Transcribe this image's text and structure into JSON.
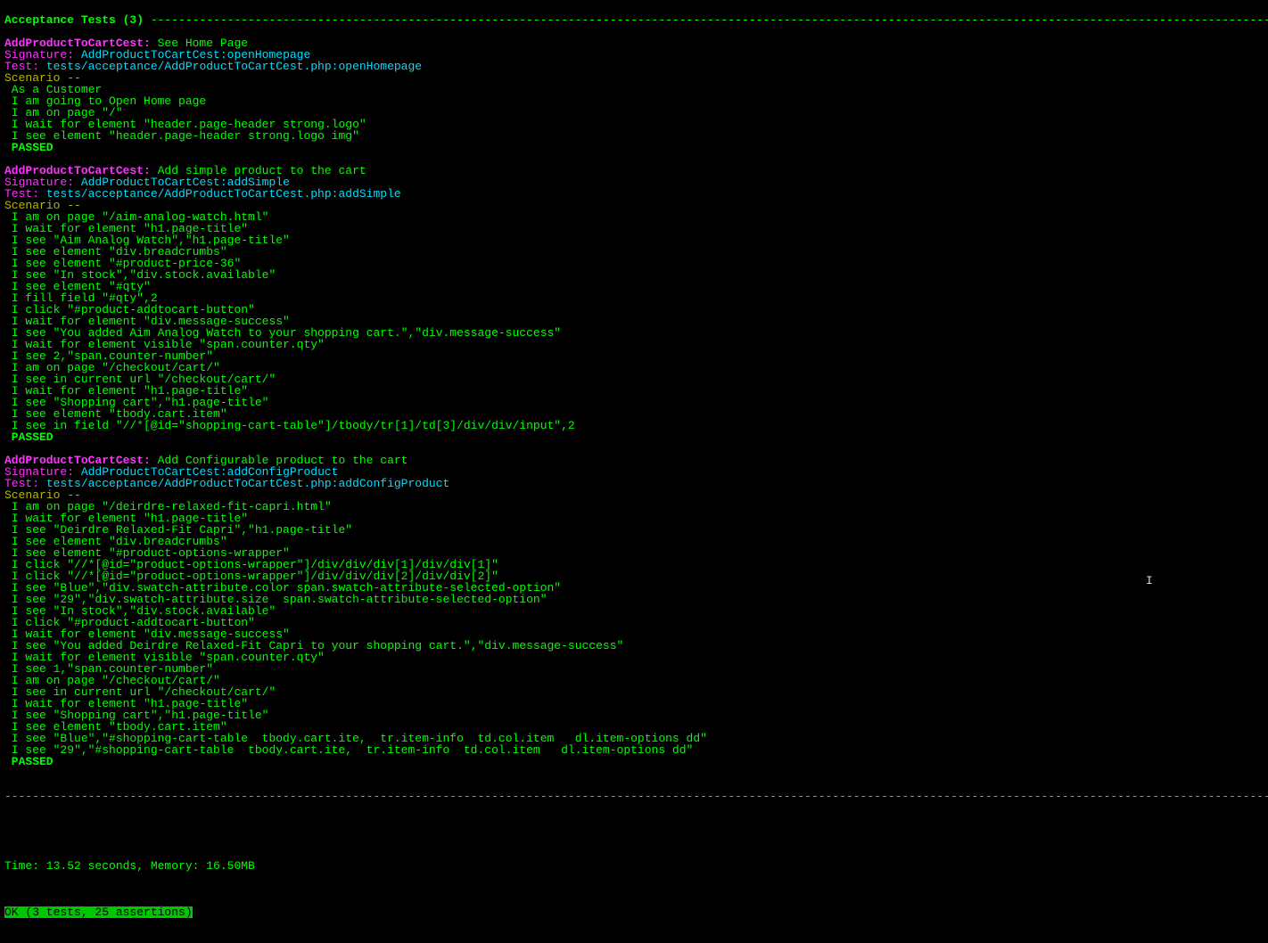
{
  "header": "Acceptance Tests (3) ",
  "dashFill": "---------------------------------------------------------------------------------------------------------------------------------------------------------------------------------------------",
  "tests": [
    {
      "cest": "AddProductToCartCest:",
      "title": " See Home Page",
      "sigLabel": "Signature: ",
      "sigValue": "AddProductToCartCest:openHomepage",
      "testLabel": "Test: ",
      "testValue": "tests/acceptance/AddProductToCartCest.php:openHomepage",
      "scenario": "Scenario --",
      "steps": [
        " As a Customer",
        " I am going to Open Home page",
        " I am on page \"/\"",
        " I wait for element \"header.page-header strong.logo\"",
        " I see element \"header.page-header strong.logo img\""
      ],
      "passed": " PASSED"
    },
    {
      "cest": "AddProductToCartCest:",
      "title": " Add simple product to the cart",
      "sigLabel": "Signature: ",
      "sigValue": "AddProductToCartCest:addSimple",
      "testLabel": "Test: ",
      "testValue": "tests/acceptance/AddProductToCartCest.php:addSimple",
      "scenario": "Scenario --",
      "steps": [
        " I am on page \"/aim-analog-watch.html\"",
        " I wait for element \"h1.page-title\"",
        " I see \"Aim Analog Watch\",\"h1.page-title\"",
        " I see element \"div.breadcrumbs\"",
        " I see element \"#product-price-36\"",
        " I see \"In stock\",\"div.stock.available\"",
        " I see element \"#qty\"",
        " I fill field \"#qty\",2",
        " I click \"#product-addtocart-button\"",
        " I wait for element \"div.message-success\"",
        " I see \"You added Aim Analog Watch to your shopping cart.\",\"div.message-success\"",
        " I wait for element visible \"span.counter.qty\"",
        " I see 2,\"span.counter-number\"",
        " I am on page \"/checkout/cart/\"",
        " I see in current url \"/checkout/cart/\"",
        " I wait for element \"h1.page-title\"",
        " I see \"Shopping cart\",\"h1.page-title\"",
        " I see element \"tbody.cart.item\"",
        " I see in field \"//*[@id=\"shopping-cart-table\"]/tbody/tr[1]/td[3]/div/div/input\",2"
      ],
      "passed": " PASSED"
    },
    {
      "cest": "AddProductToCartCest:",
      "title": " Add Configurable product to the cart",
      "sigLabel": "Signature: ",
      "sigValue": "AddProductToCartCest:addConfigProduct",
      "testLabel": "Test: ",
      "testValue": "tests/acceptance/AddProductToCartCest.php:addConfigProduct",
      "scenario": "Scenario --",
      "steps": [
        " I am on page \"/deirdre-relaxed-fit-capri.html\"",
        " I wait for element \"h1.page-title\"",
        " I see \"Deirdre Relaxed-Fit Capri\",\"h1.page-title\"",
        " I see element \"div.breadcrumbs\"",
        " I see element \"#product-options-wrapper\"",
        " I click \"//*[@id=\"product-options-wrapper\"]/div/div/div[1]/div/div[1]\"",
        " I click \"//*[@id=\"product-options-wrapper\"]/div/div/div[2]/div/div[2]\"",
        " I see \"Blue\",\"div.swatch-attribute.color span.swatch-attribute-selected-option\"",
        " I see \"29\",\"div.swatch-attribute.size  span.swatch-attribute-selected-option\"",
        " I see \"In stock\",\"div.stock.available\"",
        " I click \"#product-addtocart-button\"",
        " I wait for element \"div.message-success\"",
        " I see \"You added Deirdre Relaxed-Fit Capri to your shopping cart.\",\"div.message-success\"",
        " I wait for element visible \"span.counter.qty\"",
        " I see 1,\"span.counter-number\"",
        " I am on page \"/checkout/cart/\"",
        " I see in current url \"/checkout/cart/\"",
        " I wait for element \"h1.page-title\"",
        " I see \"Shopping cart\",\"h1.page-title\"",
        " I see element \"tbody.cart.item\"",
        " I see \"Blue\",\"#shopping-cart-table  tbody.cart.ite,  tr.item-info  td.col.item   dl.item-options dd\"",
        " I see \"29\",\"#shopping-cart-table  tbody.cart.ite,  tr.item-info  td.col.item   dl.item-options dd\""
      ],
      "passed": " PASSED"
    }
  ],
  "sepLine": "----------------------------------------------------------------------------------------------------------------------------------------------------------------------------------------------------------------------",
  "timeLine": "Time: 13.52 seconds, Memory: 16.50MB",
  "okLine": "OK (3 tests, 25 assertions)",
  "cursorGlyph": "I"
}
